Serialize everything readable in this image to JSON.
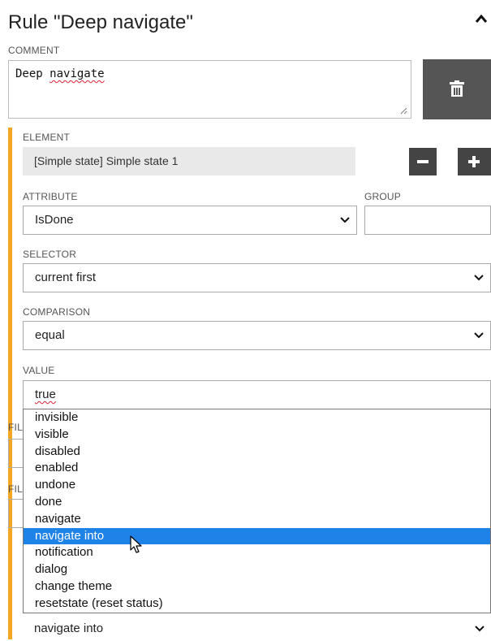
{
  "rule": {
    "title": "Rule \"Deep navigate\""
  },
  "comment": {
    "label": "COMMENT",
    "value_prefix": "Deep ",
    "value_word": "navigate"
  },
  "element": {
    "label": "ELEMENT",
    "value": "[Simple state] Simple state 1"
  },
  "attribute": {
    "label": "ATTRIBUTE",
    "value": "IsDone"
  },
  "group": {
    "label": "GROUP",
    "value": ""
  },
  "selector": {
    "label": "SELECTOR",
    "value": "current first"
  },
  "comparison": {
    "label": "COMPARISON",
    "value": "equal"
  },
  "value_field": {
    "label": "VALUE",
    "value": "true"
  },
  "partial_labels": {
    "fil1": "FIL",
    "fil2": "FIL"
  },
  "dropdown": {
    "options": [
      "invisible",
      "visible",
      "disabled",
      "enabled",
      "undone",
      "done",
      "navigate",
      "navigate into",
      "notification",
      "dialog",
      "change theme",
      "resetstate (reset status)"
    ],
    "selected": "navigate into"
  },
  "bottom_select": {
    "value": "navigate into"
  },
  "colors": {
    "accent": "#f5a623",
    "selection": "#1e82e6",
    "button_dark": "#444444"
  },
  "icons": [
    "chevron-up-icon",
    "trash-icon",
    "minus-icon",
    "plus-icon",
    "chevron-down-icon",
    "mouse-cursor-icon"
  ]
}
